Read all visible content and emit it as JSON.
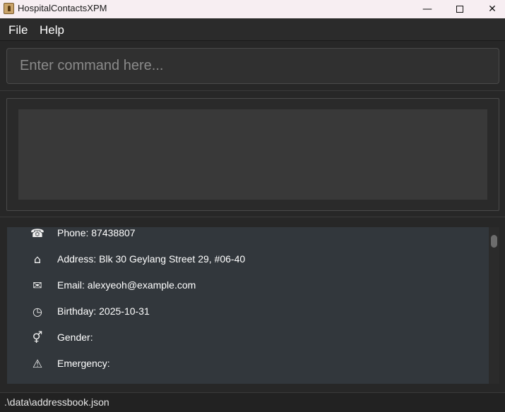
{
  "window": {
    "title": "HospitalContactsXPM",
    "minimize_glyph": "—",
    "close_glyph": "✕"
  },
  "menu": {
    "file": "File",
    "help": "Help"
  },
  "command": {
    "value": "",
    "placeholder": "Enter command here..."
  },
  "result": {
    "text": ""
  },
  "details": [
    {
      "icon": "phone-icon",
      "glyph": "☎",
      "text": "Phone: 87438807"
    },
    {
      "icon": "home-icon",
      "glyph": "⌂",
      "text": "Address: Blk 30 Geylang Street 29, #06-40"
    },
    {
      "icon": "envelope-icon",
      "glyph": "✉",
      "text": "Email: alexyeoh@example.com"
    },
    {
      "icon": "clock-icon",
      "glyph": "◷",
      "text": "Birthday: 2025-10-31"
    },
    {
      "icon": "gender-icon",
      "glyph": "⚥",
      "text": "Gender:"
    },
    {
      "icon": "warning-icon",
      "glyph": "⚠",
      "text": "Emergency:"
    }
  ],
  "status": {
    "file_path": ".\\data\\addressbook.json"
  }
}
